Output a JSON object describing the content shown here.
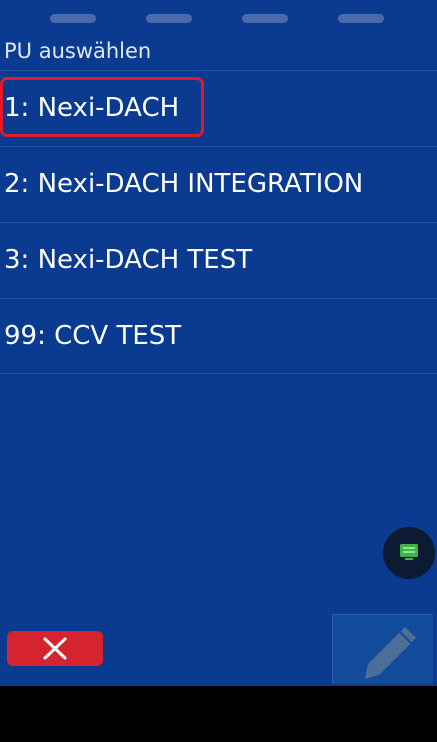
{
  "header": {
    "title": "PU auswählen"
  },
  "list": {
    "items": [
      {
        "label": "1: Nexi-DACH",
        "highlighted": true
      },
      {
        "label": "2: Nexi-DACH INTEGRATION",
        "highlighted": false
      },
      {
        "label": "3: Nexi-DACH TEST",
        "highlighted": false
      },
      {
        "label": "99: CCV TEST",
        "highlighted": false
      }
    ]
  },
  "icons": {
    "fab": "monitor-icon",
    "cancel": "close-icon",
    "edit": "pencil-icon"
  },
  "colors": {
    "background": "#0b3a91",
    "cancel": "#d5242f",
    "highlight_border": "#e41a2c",
    "fab_icon": "#3fb24a"
  }
}
